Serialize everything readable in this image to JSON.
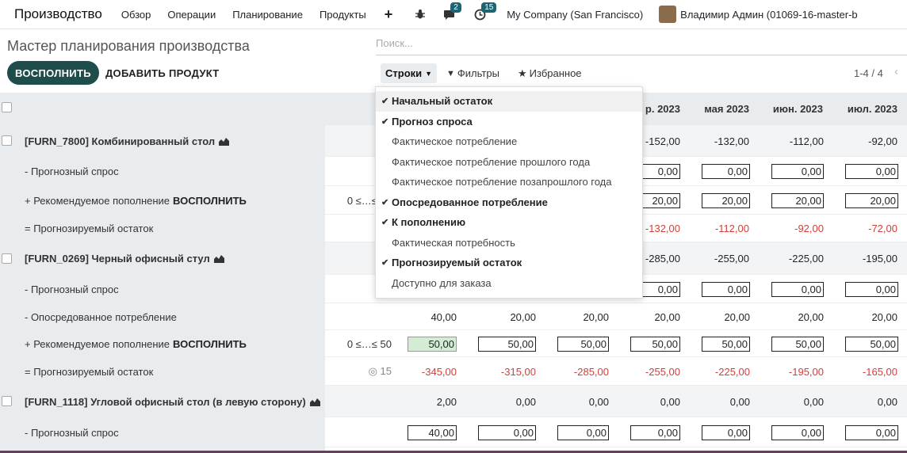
{
  "navbar": {
    "app": "Производство",
    "menu": [
      "Обзор",
      "Операции",
      "Планирование",
      "Продукты"
    ],
    "plus": "+",
    "chat_count": "2",
    "activity_count": "15",
    "company": "My Company (San Francisco)",
    "user": "Владимир Админ (01069-16-master-b"
  },
  "control": {
    "title": "Мастер планирования производства",
    "search_placeholder": "Поиск...",
    "replenish": "ВОСПОЛНИТЬ",
    "add_product": "ДОБАВИТЬ ПРОДУКТ",
    "rows_toggle": "Строки",
    "filters": "Фильтры",
    "favorites": "Избранное",
    "pager": "1-4 / 4"
  },
  "columns": [
    "р. 2023",
    "мая 2023",
    "июн. 2023",
    "июл. 2023"
  ],
  "dropdown": [
    {
      "label": "Начальный остаток",
      "checked": true
    },
    {
      "label": "Прогноз спроса",
      "checked": true
    },
    {
      "label": "Фактическое потребление",
      "checked": false
    },
    {
      "label": "Фактическое потребление прошлого года",
      "checked": false
    },
    {
      "label": "Фактическое потребление позапрошлого года",
      "checked": false
    },
    {
      "label": "Опосредованное потребление",
      "checked": true
    },
    {
      "label": "К пополнению",
      "checked": true
    },
    {
      "label": "Фактическая потребность",
      "checked": false
    },
    {
      "label": "Прогнозируемый остаток",
      "checked": true
    },
    {
      "label": "Доступно для заказа",
      "checked": false
    }
  ],
  "rows": {
    "p1": {
      "name": "[FURN_7800] Комбинированный стол",
      "vals": [
        "-152,00",
        "-132,00",
        "-112,00",
        "-92,00"
      ]
    },
    "p1_demand": {
      "name": "- Прогнозный спрос",
      "vals": [
        "0,00",
        "0,00",
        "0,00",
        "0,00"
      ]
    },
    "p1_repl": {
      "name": "+ Рекомендуемое пополнение",
      "link": "ВОСПОЛНИТЬ",
      "range": "0 ≤…≤ 50",
      "vals": [
        "20,00",
        "20,00",
        "20,00",
        "20,00"
      ]
    },
    "p1_fc": {
      "name": "= Прогнозируемый остаток",
      "vals": [
        "-132,00",
        "-112,00",
        "-92,00",
        "-72,00"
      ]
    },
    "p2": {
      "name": "[FURN_0269] Черный офисный стул",
      "vals": [
        "-285,00",
        "-255,00",
        "-225,00",
        "-195,00"
      ]
    },
    "p2_demand": {
      "name": "- Прогнозный спрос",
      "vals": [
        "0,00",
        "0,00",
        "0,00",
        "0,00"
      ]
    },
    "p2_indirect": {
      "name": "- Опосредованное потребление",
      "vals": [
        "40,00",
        "20,00",
        "20,00",
        "20,00",
        "20,00",
        "20,00",
        "20,00"
      ]
    },
    "p2_repl": {
      "name": "+ Рекомендуемое пополнение",
      "link": "ВОСПОЛНИТЬ",
      "range": "0 ≤…≤ 50",
      "vals": [
        "50,00",
        "50,00",
        "50,00",
        "50,00",
        "50,00",
        "50,00",
        "50,00"
      ]
    },
    "p2_fc": {
      "name": "= Прогнозируемый остаток",
      "safety": "◎ 15",
      "vals": [
        "-345,00",
        "-315,00",
        "-285,00",
        "-255,00",
        "-225,00",
        "-195,00",
        "-165,00"
      ]
    },
    "p3": {
      "name": "[FURN_1118] Угловой офисный стол (в левую сторону)",
      "vals": [
        "2,00",
        "0,00",
        "0,00",
        "0,00",
        "0,00",
        "0,00",
        "0,00"
      ]
    },
    "p3_demand": {
      "name": "- Прогнозный спрос",
      "vals": [
        "40,00",
        "0,00",
        "0,00",
        "0,00",
        "0,00",
        "0,00",
        "0,00"
      ]
    }
  }
}
